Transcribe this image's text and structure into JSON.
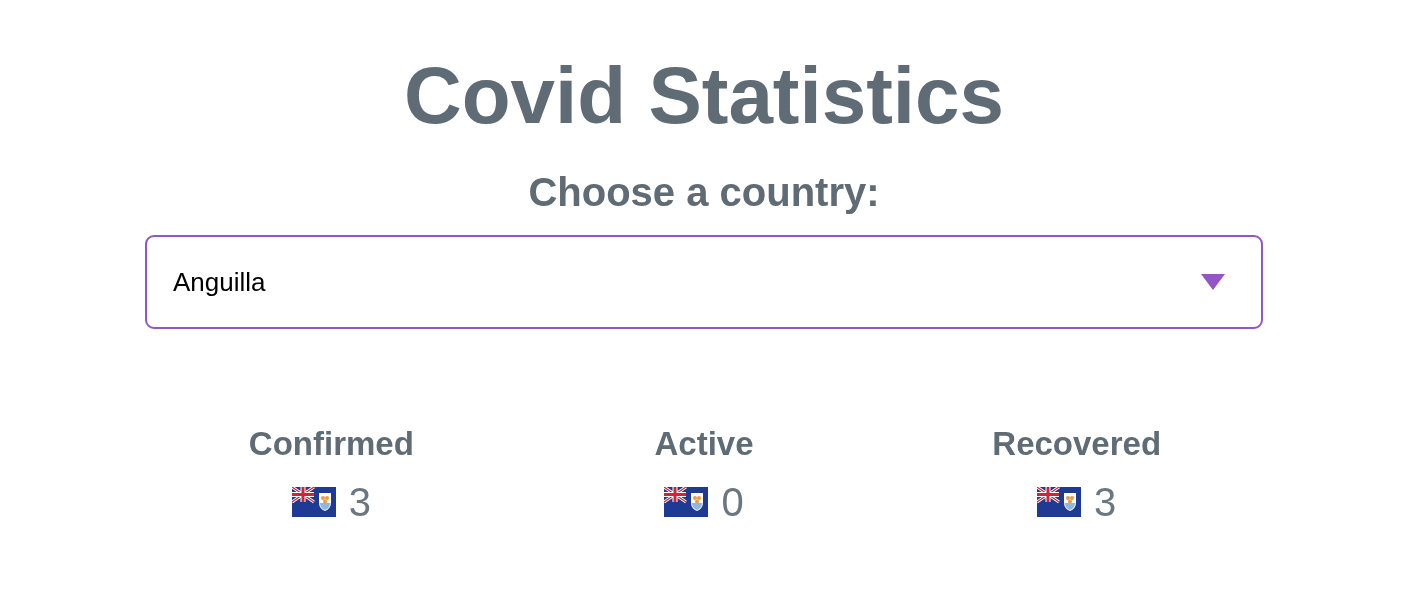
{
  "title": "Covid Statistics",
  "prompt": "Choose a country:",
  "country_select": {
    "value": "Anguilla"
  },
  "stats": [
    {
      "label": "Confirmed",
      "value": "3"
    },
    {
      "label": "Active",
      "value": "0"
    },
    {
      "label": "Recovered",
      "value": "3"
    }
  ]
}
